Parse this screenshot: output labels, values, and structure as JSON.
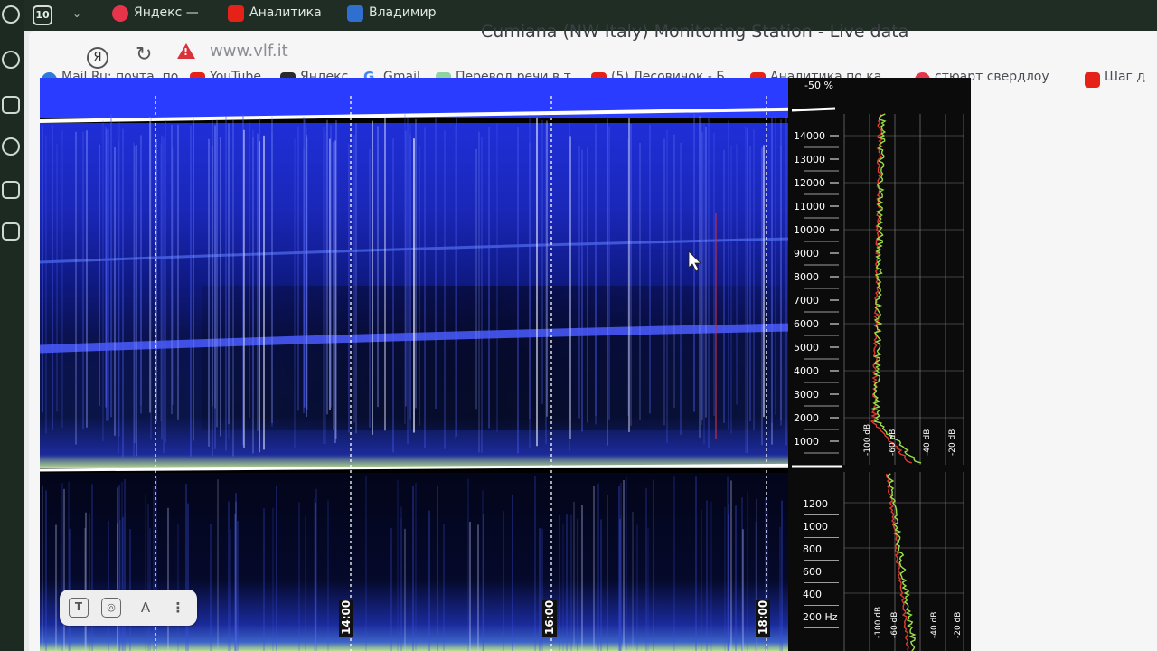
{
  "browser": {
    "tab_count": "10",
    "tabs": [
      {
        "label": "Яндекс —",
        "icon": "yandex-icon"
      },
      {
        "label": "Аналитика",
        "icon": "youtube-icon"
      },
      {
        "label": "Владимир",
        "icon": "vk-icon"
      }
    ],
    "url": "www.vlf.it",
    "page_title": "Cumiana (NW Italy) Monitoring Station - Live data",
    "bookmarks": [
      {
        "label": "Mail.Ru: почта, по",
        "icon": "mailru-icon"
      },
      {
        "label": "YouTube",
        "icon": "youtube-icon"
      },
      {
        "label": "Яндекс",
        "icon": "yandex-icon"
      },
      {
        "label": "Gmail",
        "icon": "gmail-icon"
      },
      {
        "label": "Перевод речи в т",
        "icon": "translate-icon"
      },
      {
        "label": "(5) Лесовичок - Б",
        "icon": "youtube-icon"
      },
      {
        "label": "Аналитика по ка",
        "icon": "youtube-icon"
      },
      {
        "label": "стюарт свердлоу",
        "icon": "yandex-icon"
      },
      {
        "label": "Шаг д",
        "icon": "youtube-icon"
      }
    ]
  },
  "spectrogram": {
    "level_label": "-50 %",
    "upper_freq_labels": [
      "14000",
      "13000",
      "12000",
      "11000",
      "10000",
      "9000",
      "8000",
      "7000",
      "6000",
      "5000",
      "4000",
      "3000",
      "2000",
      "1000"
    ],
    "lower_freq_labels": [
      "1200",
      "1000",
      "800",
      "600",
      "400",
      "200 Hz"
    ],
    "time_labels": [
      "14:00",
      "16:00",
      "18:00"
    ],
    "db_labels": [
      "-100 dB",
      "-60 dB",
      "-40 dB",
      "-20 dB"
    ],
    "colors": {
      "background": "#05081c",
      "band": "#2a3cff",
      "noise_floor": "#b8e08a",
      "trace_red": "#e03a30",
      "trace_green": "#9be04a"
    }
  },
  "toolbar_pill": {
    "icons": [
      "text-select-icon",
      "lens-icon",
      "translate-icon",
      "more-icon"
    ],
    "translate_glyph": "A"
  }
}
